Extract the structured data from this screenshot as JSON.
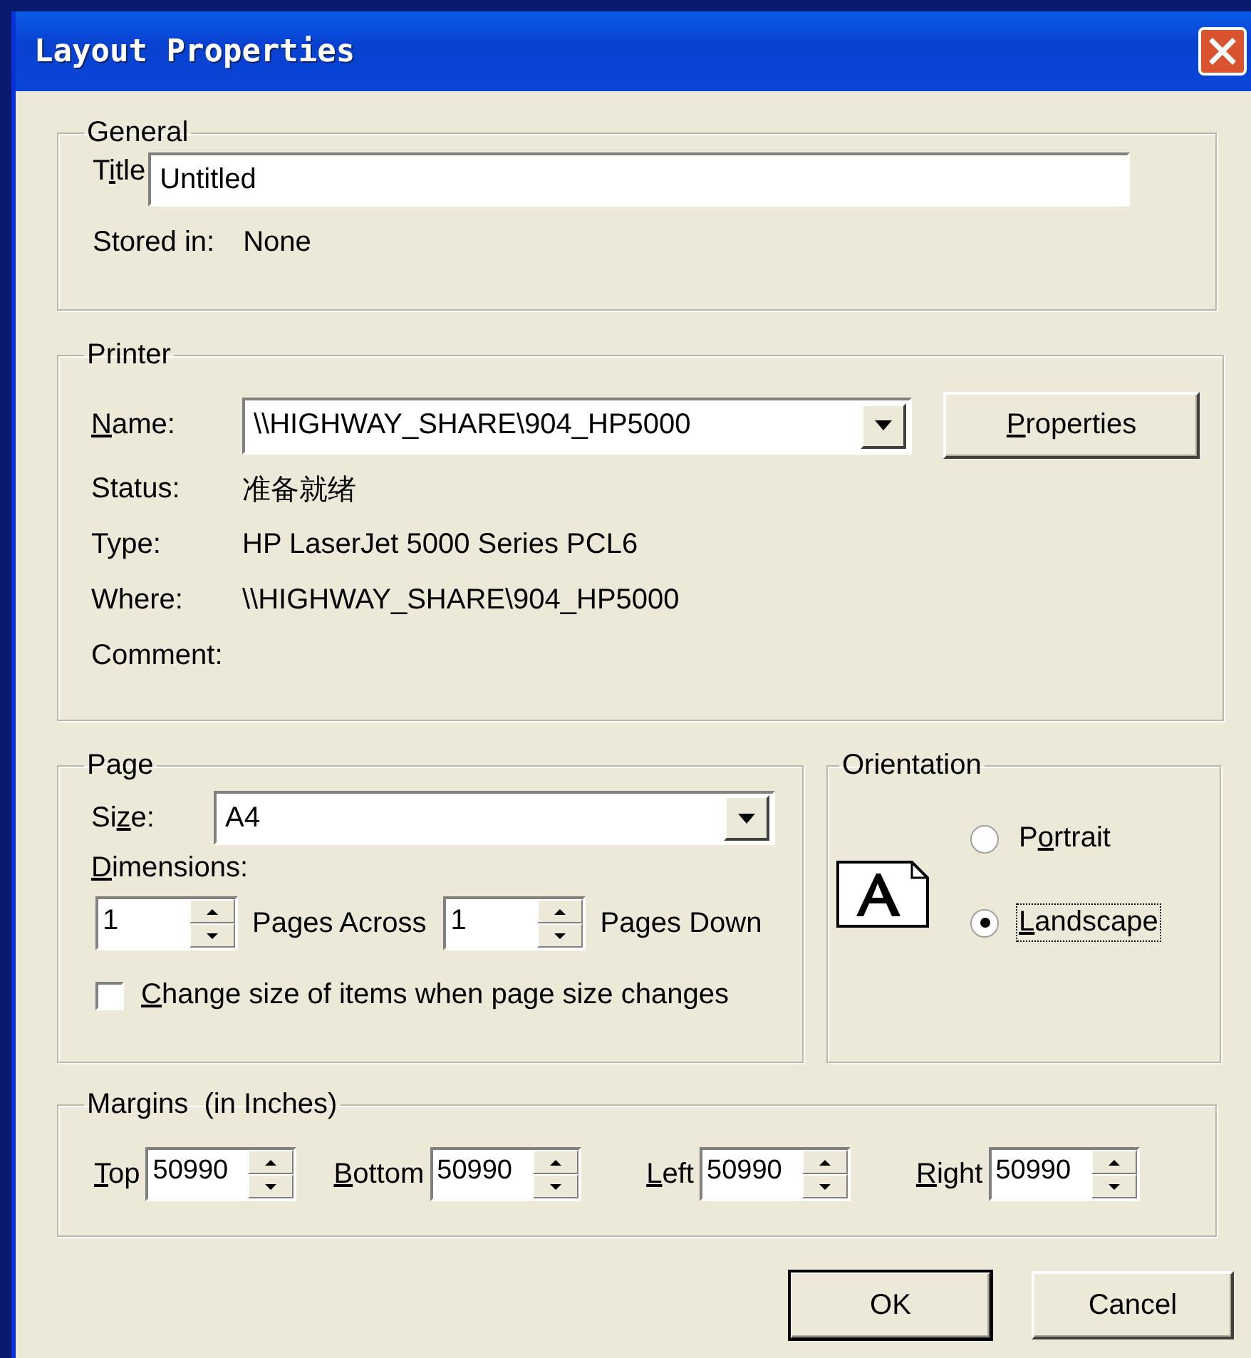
{
  "window": {
    "title": "Layout Properties"
  },
  "general": {
    "legend": "General",
    "title_label": {
      "pre": "T",
      "key": "i",
      "post": "tle"
    },
    "title_value": "Untitled",
    "stored_label": "Stored in:",
    "stored_value": "None"
  },
  "printer": {
    "legend": "Printer",
    "name_label": {
      "key": "N",
      "post": "ame:"
    },
    "name_value": "\\\\HIGHWAY_SHARE\\904_HP5000",
    "properties_button": {
      "key": "P",
      "post": "roperties"
    },
    "info": [
      {
        "label": "Status:",
        "value": "准备就绪"
      },
      {
        "label": "Type:",
        "value": "HP LaserJet 5000 Series PCL6"
      },
      {
        "label": "Where:",
        "value": "\\\\HIGHWAY_SHARE\\904_HP5000"
      },
      {
        "label": "Comment:"
      }
    ]
  },
  "page": {
    "legend": "Page",
    "size_label": {
      "pre": "Si",
      "key": "z",
      "post": "e:"
    },
    "size_value": "A4",
    "dimensions_label": {
      "key": "D",
      "post": "imensions:"
    },
    "across_value": "1",
    "across_label": "Pages Across",
    "down_value": "1",
    "down_label": "Pages Down",
    "resize_checkbox": {
      "key": "C",
      "post": "hange size of items when page size changes",
      "checked": false
    }
  },
  "orientation": {
    "legend": "Orientation",
    "options": [
      {
        "pre": "P",
        "key": "o",
        "post": "rtrait",
        "selected": false,
        "focused": false
      },
      {
        "key": "L",
        "post": "andscape",
        "selected": true,
        "focused": true
      }
    ]
  },
  "margins": {
    "legend": "Margins  (in Inches)",
    "fields": [
      {
        "label": {
          "key": "T",
          "post": "op"
        },
        "value": "50990"
      },
      {
        "label": {
          "key": "B",
          "post": "ottom"
        },
        "value": "50990"
      },
      {
        "label": {
          "key": "L",
          "post": "eft"
        },
        "value": "50990"
      },
      {
        "label": {
          "key": "R",
          "post": "ight"
        },
        "value": "50990"
      }
    ]
  },
  "buttons": [
    {
      "text": "OK",
      "default": true
    },
    {
      "text": "Cancel",
      "default": false
    }
  ]
}
